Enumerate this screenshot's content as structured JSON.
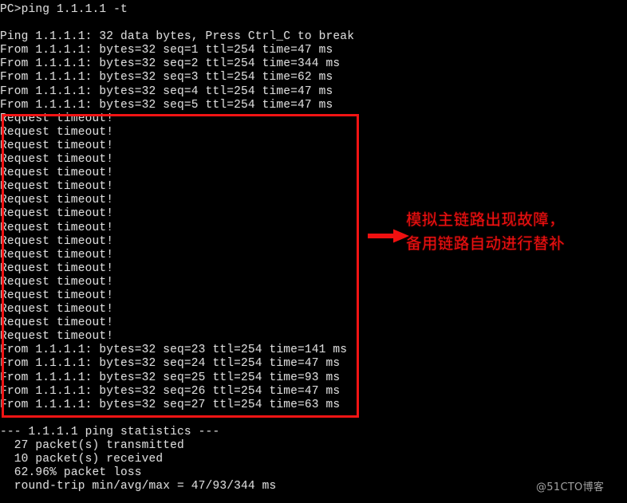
{
  "terminal": {
    "lines": [
      "PC>ping 1.1.1.1 -t",
      "",
      "Ping 1.1.1.1: 32 data bytes, Press Ctrl_C to break",
      "From 1.1.1.1: bytes=32 seq=1 ttl=254 time=47 ms",
      "From 1.1.1.1: bytes=32 seq=2 ttl=254 time=344 ms",
      "From 1.1.1.1: bytes=32 seq=3 ttl=254 time=62 ms",
      "From 1.1.1.1: bytes=32 seq=4 ttl=254 time=47 ms",
      "From 1.1.1.1: bytes=32 seq=5 ttl=254 time=47 ms",
      "Request timeout!",
      "Request timeout!",
      "Request timeout!",
      "Request timeout!",
      "Request timeout!",
      "Request timeout!",
      "Request timeout!",
      "Request timeout!",
      "Request timeout!",
      "Request timeout!",
      "Request timeout!",
      "Request timeout!",
      "Request timeout!",
      "Request timeout!",
      "Request timeout!",
      "Request timeout!",
      "Request timeout!",
      "From 1.1.1.1: bytes=32 seq=23 ttl=254 time=141 ms",
      "From 1.1.1.1: bytes=32 seq=24 ttl=254 time=47 ms",
      "From 1.1.1.1: bytes=32 seq=25 ttl=254 time=93 ms",
      "From 1.1.1.1: bytes=32 seq=26 ttl=254 time=47 ms",
      "From 1.1.1.1: bytes=32 seq=27 ttl=254 time=63 ms",
      "",
      "--- 1.1.1.1 ping statistics ---",
      "  27 packet(s) transmitted",
      "  10 packet(s) received",
      "  62.96% packet loss",
      "  round-trip min/avg/max = 47/93/344 ms"
    ],
    "prompt": "PC>",
    "command": "ping 1.1.1.1 -t",
    "target_ip": "1.1.1.1",
    "data_bytes": "32",
    "break_hint": "Press Ctrl_C to break",
    "statistics": {
      "header": "--- 1.1.1.1 ping statistics ---",
      "transmitted": "27 packet(s) transmitted",
      "received": "10 packet(s) received",
      "packet_loss": "62.96% packet loss",
      "round_trip": "round-trip min/avg/max = 47/93/344 ms"
    }
  },
  "annotation": {
    "line1": "模拟主链路出现故障，",
    "line2": "备用链路自动进行替补",
    "color": "#f01010",
    "arrow_icon": "right-arrow-icon"
  },
  "highlight_box": {
    "color": "#f21414",
    "label": "timeout-and-recovery-highlight"
  },
  "watermark": {
    "text": "@51CTO博客"
  }
}
